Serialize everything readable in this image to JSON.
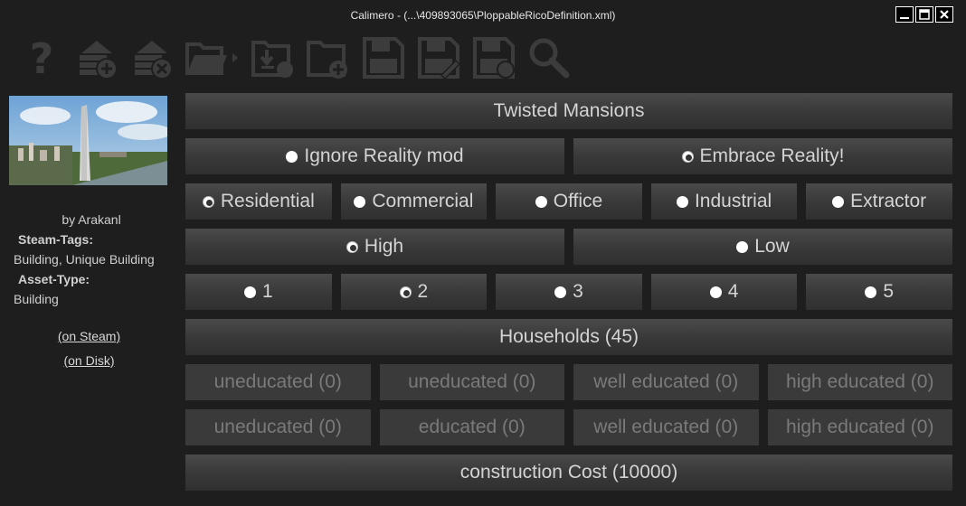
{
  "window": {
    "title": "Calimero - (...\\409893065\\PloppableRicoDefinition.xml)",
    "controls": [
      "minimize",
      "maximize",
      "close"
    ]
  },
  "toolbar": {
    "icons": [
      "help-icon",
      "add-building-icon",
      "remove-building-icon",
      "open-folder-icon",
      "import-icon",
      "new-file-icon",
      "save-icon",
      "save-as-icon",
      "save-to-icon",
      "search-icon"
    ]
  },
  "sidebar": {
    "author": "by Arakanl",
    "steam_tags_label": "Steam-Tags:",
    "steam_tags_value": "Building, Unique Building",
    "asset_type_label": "Asset-Type:",
    "asset_type_value": "Building",
    "link_steam": "(on Steam)",
    "link_disk": "(on Disk)"
  },
  "main": {
    "building_name": "Twisted Mansions",
    "reality": [
      {
        "label": "Ignore Reality mod",
        "selected": false
      },
      {
        "label": "Embrace Reality!",
        "selected": true
      }
    ],
    "service": [
      {
        "label": "Residential",
        "selected": true
      },
      {
        "label": "Commercial",
        "selected": false
      },
      {
        "label": "Office",
        "selected": false
      },
      {
        "label": "Industrial",
        "selected": false
      },
      {
        "label": "Extractor",
        "selected": false
      }
    ],
    "density": [
      {
        "label": "High",
        "selected": true
      },
      {
        "label": "Low",
        "selected": false
      }
    ],
    "level": [
      {
        "label": "1",
        "selected": false
      },
      {
        "label": "2",
        "selected": true
      },
      {
        "label": "3",
        "selected": false
      },
      {
        "label": "4",
        "selected": false
      },
      {
        "label": "5",
        "selected": false
      }
    ],
    "households": "Households (45)",
    "workers_row1": [
      "uneducated (0)",
      "uneducated (0)",
      "well educated (0)",
      "high educated (0)"
    ],
    "workers_row2": [
      "uneducated (0)",
      "educated (0)",
      "well educated (0)",
      "high educated (0)"
    ],
    "construction_cost": "construction Cost (10000)"
  }
}
